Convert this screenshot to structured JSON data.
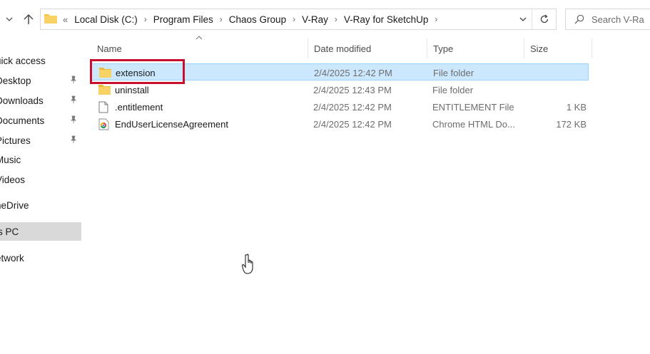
{
  "addressbar": {
    "overflow": "«",
    "crumbs": [
      "Local Disk (C:)",
      "Program Files",
      "Chaos Group",
      "V-Ray",
      "V-Ray for SketchUp"
    ],
    "search_placeholder": "Search V-Ra"
  },
  "navpane": {
    "items": [
      {
        "label": "uick access",
        "pinned": false
      },
      {
        "label": "Desktop",
        "pinned": true
      },
      {
        "label": "Downloads",
        "pinned": true
      },
      {
        "label": "Documents",
        "pinned": true
      },
      {
        "label": "Pictures",
        "pinned": true
      },
      {
        "label": "Music",
        "pinned": false
      },
      {
        "label": "Videos",
        "pinned": false
      },
      {
        "label": "neDrive",
        "pinned": false
      },
      {
        "label": "is PC",
        "pinned": false,
        "selected": true
      },
      {
        "label": "etwork",
        "pinned": false
      }
    ]
  },
  "columns": {
    "name": "Name",
    "date": "Date modified",
    "type": "Type",
    "size": "Size"
  },
  "files": [
    {
      "name": "extension",
      "date": "2/4/2025 12:42 PM",
      "type": "File folder",
      "size": "",
      "icon": "folder-icon",
      "selected": true
    },
    {
      "name": "uninstall",
      "date": "2/4/2025 12:43 PM",
      "type": "File folder",
      "size": "",
      "icon": "folder-icon",
      "selected": false
    },
    {
      "name": ".entitlement",
      "date": "2/4/2025 12:42 PM",
      "type": "ENTITLEMENT File",
      "size": "1 KB",
      "icon": "file-icon",
      "selected": false
    },
    {
      "name": "EndUserLicenseAgreement",
      "date": "2/4/2025 12:42 PM",
      "type": "Chrome HTML Do...",
      "size": "172 KB",
      "icon": "chrome-html-icon",
      "selected": false
    }
  ],
  "colors": {
    "selection_bg": "#cce8ff",
    "selection_border": "#99d1ff",
    "annotation": "#c8102e",
    "folder": "#f5c542"
  }
}
